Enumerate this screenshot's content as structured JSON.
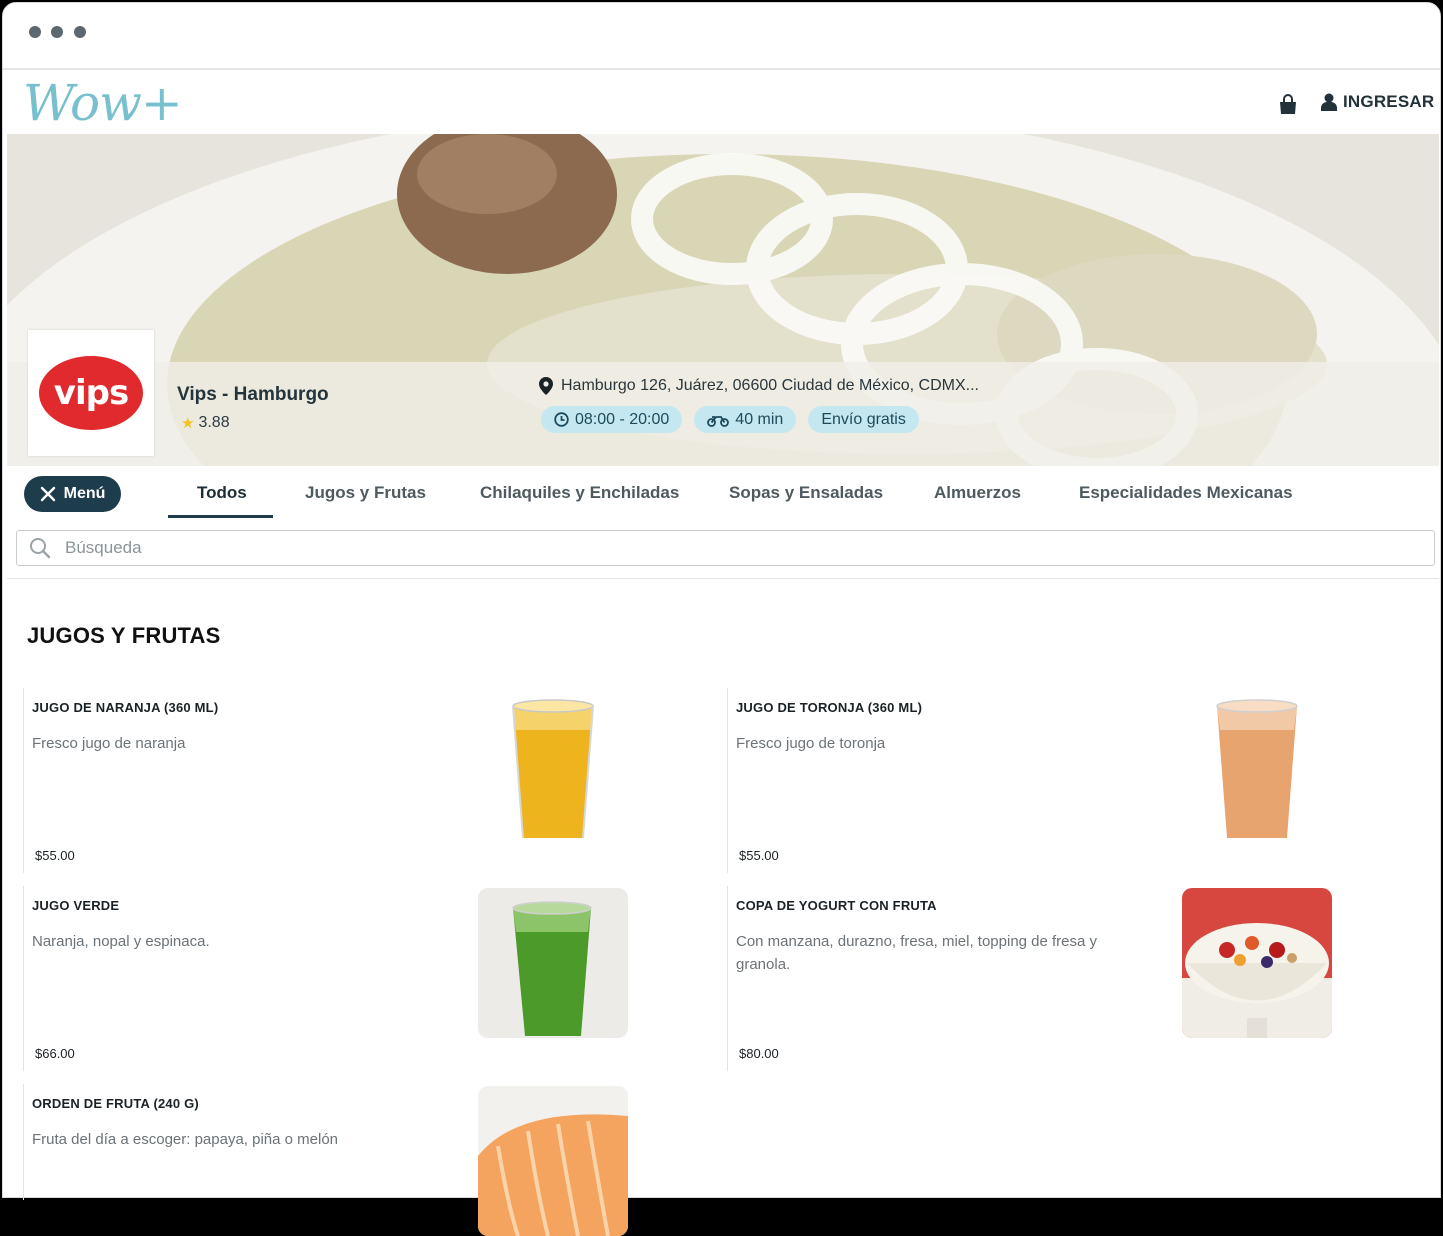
{
  "app": {
    "logo_text": "Wow+"
  },
  "header": {
    "login_label": "INGRESAR",
    "cart_icon": "shopping-bag-icon",
    "user_icon": "user-icon"
  },
  "store": {
    "logo_text": "vips",
    "name": "Vips - Hamburgo",
    "rating": "3.88",
    "address": "Hamburgo 126, Juárez, 06600 Ciudad de México, CDMX...",
    "hours": "08:00 - 20:00",
    "delivery_time": "40 min",
    "shipping": "Envío gratis"
  },
  "nav": {
    "menu_label": "Menú",
    "tabs": [
      "Todos",
      "Jugos y Frutas",
      "Chilaquiles y Enchiladas",
      "Sopas y Ensaladas",
      "Almuerzos",
      "Especialidades Mexicanas"
    ]
  },
  "search": {
    "placeholder": "Búsqueda"
  },
  "section": {
    "title": "JUGOS Y FRUTAS"
  },
  "products": [
    {
      "name": "JUGO DE NARANJA (360 ML)",
      "description": "Fresco jugo de naranja",
      "price": "$55.00"
    },
    {
      "name": "JUGO DE TORONJA (360 ML)",
      "description": "Fresco jugo de toronja",
      "price": "$55.00"
    },
    {
      "name": "JUGO VERDE",
      "description": "Naranja, nopal y espinaca.",
      "price": "$66.00"
    },
    {
      "name": "COPA DE YOGURT CON FRUTA",
      "description": "Con manzana, durazno, fresa, miel, topping de fresa y granola.",
      "price": "$80.00"
    },
    {
      "name": "ORDEN DE FRUTA (240 G)",
      "description": "Fruta del día a escoger: papaya, piña o melón",
      "price": ""
    }
  ],
  "colors": {
    "accent": "#1e3d4c",
    "chip_bg": "#c5e8f0",
    "brand_red": "#e02a2d",
    "logo_teal": "#79c0cf"
  }
}
